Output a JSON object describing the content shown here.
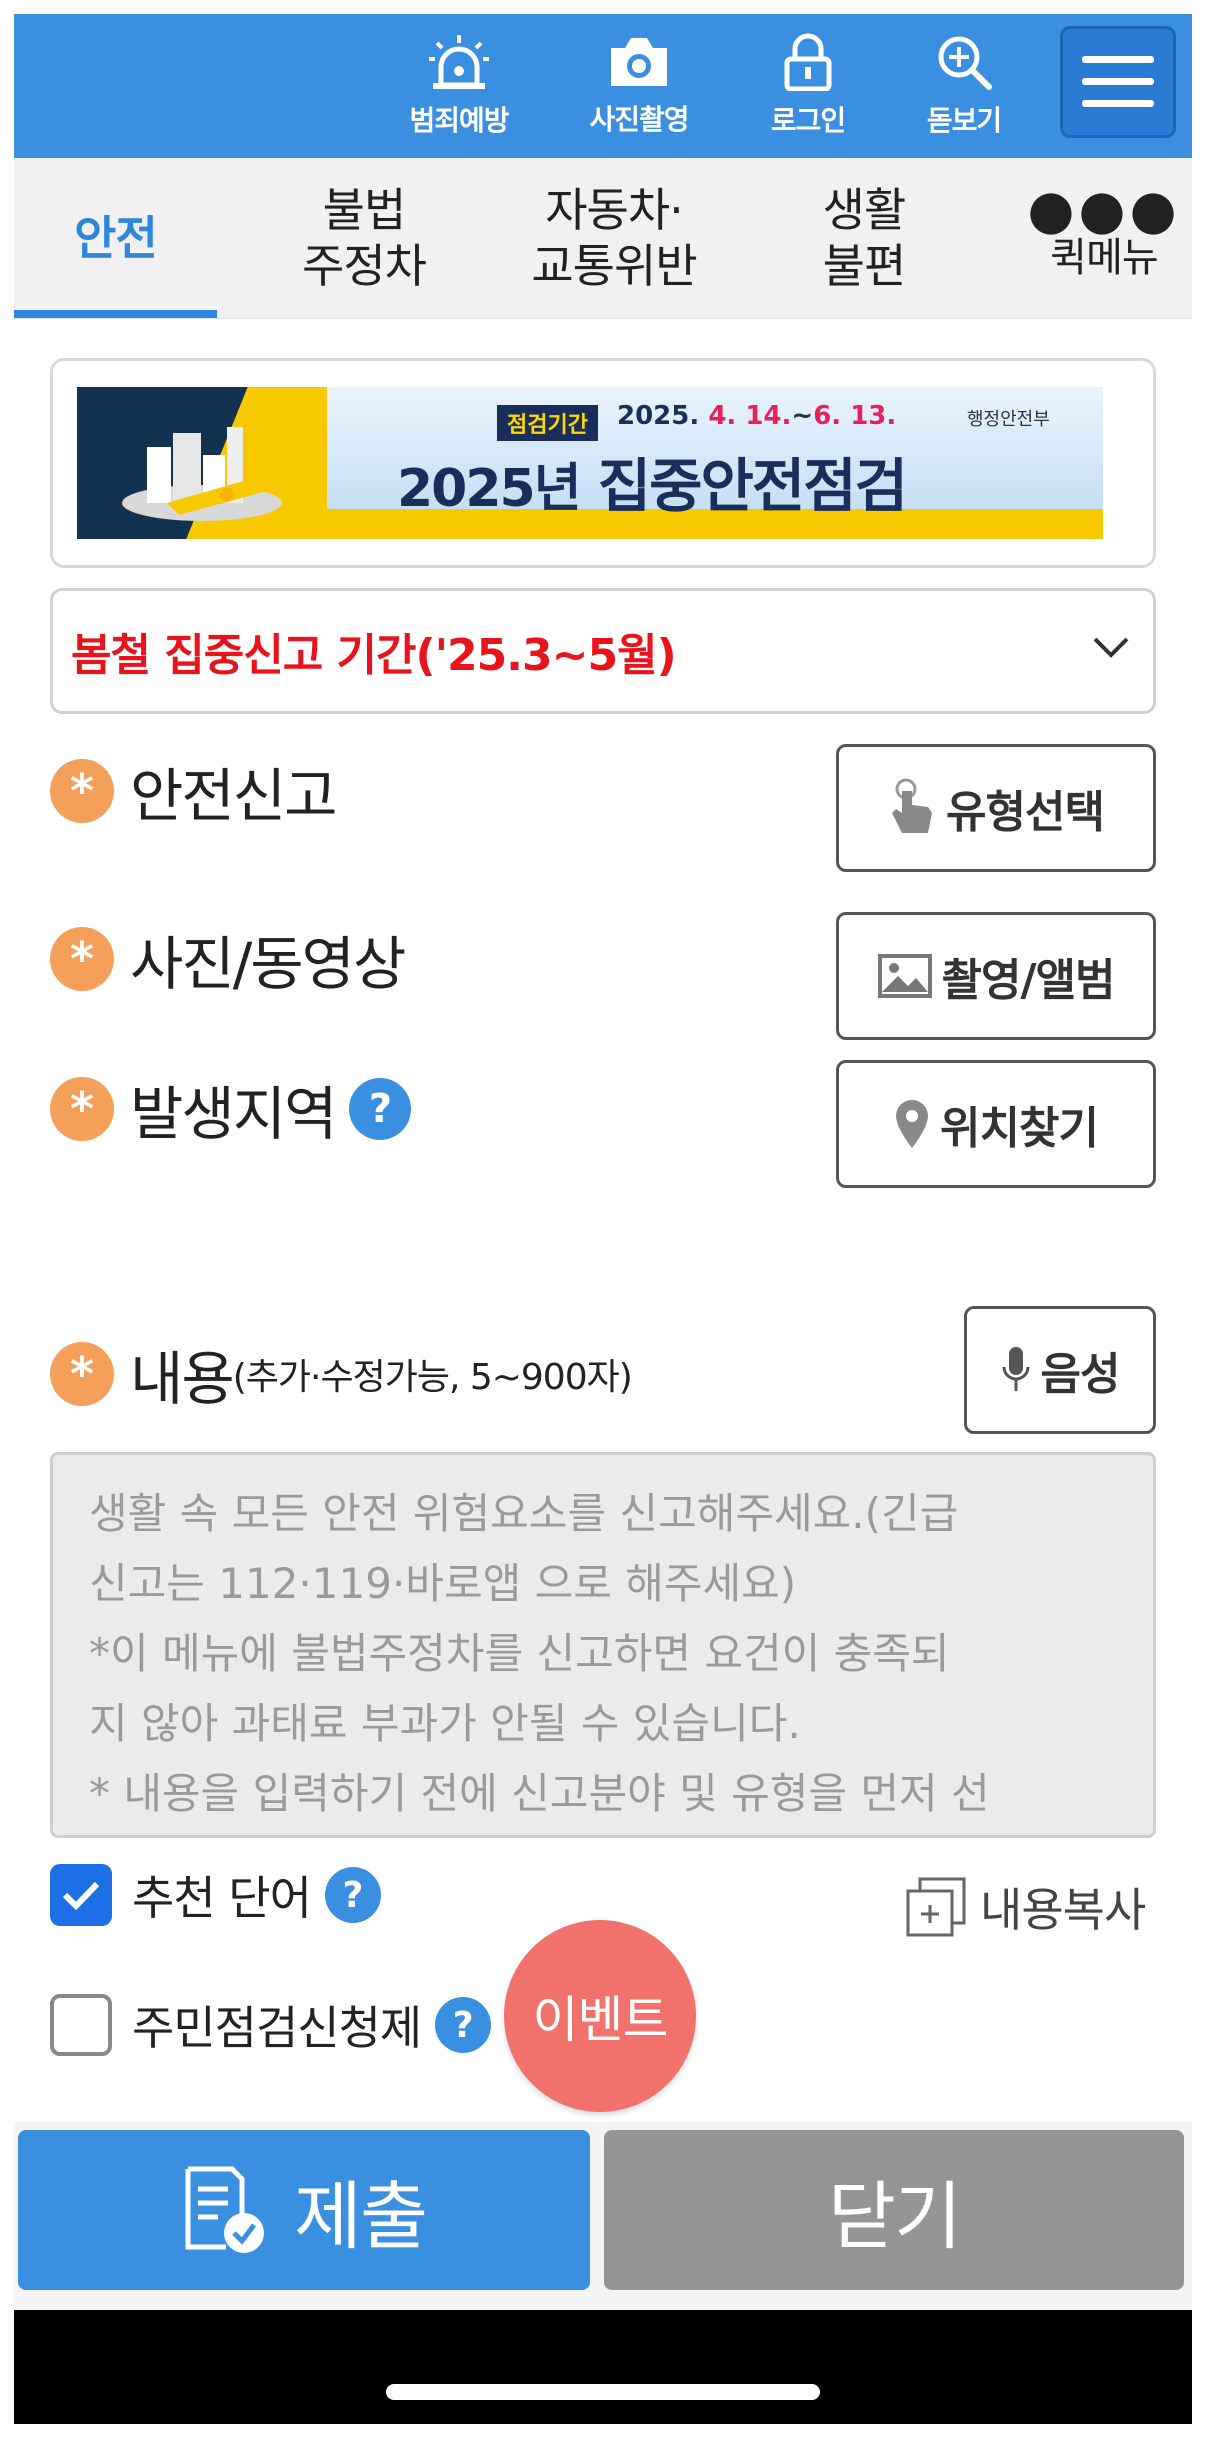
{
  "topbar": {
    "items": [
      {
        "label": "범죄예방",
        "icon": "siren-icon"
      },
      {
        "label": "사진촬영",
        "icon": "camera-icon"
      },
      {
        "label": "로그인",
        "icon": "lock-icon"
      },
      {
        "label": "돋보기",
        "icon": "magnifier-plus-icon"
      }
    ],
    "menu_icon": "hamburger-icon",
    "color": "#3b8fe0"
  },
  "tabs": [
    {
      "label": "안전",
      "active": true
    },
    {
      "label": "불법\n주정차"
    },
    {
      "label": "자동차·\n교통위반"
    },
    {
      "label": "생활\n불편"
    },
    {
      "label": "퀵메뉴",
      "icon": "more-dots-icon"
    }
  ],
  "banner": {
    "tag": "점검기간",
    "dates_prefix": "2025.",
    "dates_1": "4. 14.",
    "dates_sep": "~",
    "dates_2": "6. 13.",
    "ministry": "행정안전부",
    "headline_year": "2025년",
    "headline": "집중안전점검"
  },
  "period_select": {
    "value": "봄철 집중신고 기간('25.3~5월)",
    "icon": "chevron-down-icon"
  },
  "form": {
    "report_type": {
      "label": "안전신고",
      "button": "유형선택",
      "icon": "hand-pointer-icon"
    },
    "media": {
      "label": "사진/동영상",
      "button": "촬영/앨범",
      "icon": "image-icon"
    },
    "location": {
      "label": "발생지역",
      "button": "위치찾기",
      "icon": "map-pin-icon"
    },
    "content": {
      "label": "내용",
      "hint": "(추가·수정가능, 5~900자)",
      "voice_button": "음성",
      "placeholder": "생활 속 모든 안전 위험요소를 신고해주세요.(긴급\n신고는 112·119·바로앱 으로 해주세요)\n*이 메뉴에 불법주정차를 신고하면 요건이 충족되\n지 않아 과태료 부과가 안될 수 있습니다.\n* 내용을 입력하기 전에 신고분야 및 유형을 먼저 선"
    },
    "recommend": {
      "label": "추천 단어",
      "checked": true
    },
    "copy": {
      "label": "내용복사"
    },
    "resident": {
      "label": "주민점검신청제",
      "checked": false
    },
    "help_symbol": "?",
    "required_symbol": "*"
  },
  "event_button": "이벤트",
  "actions": {
    "submit": "제출",
    "close": "닫기"
  }
}
